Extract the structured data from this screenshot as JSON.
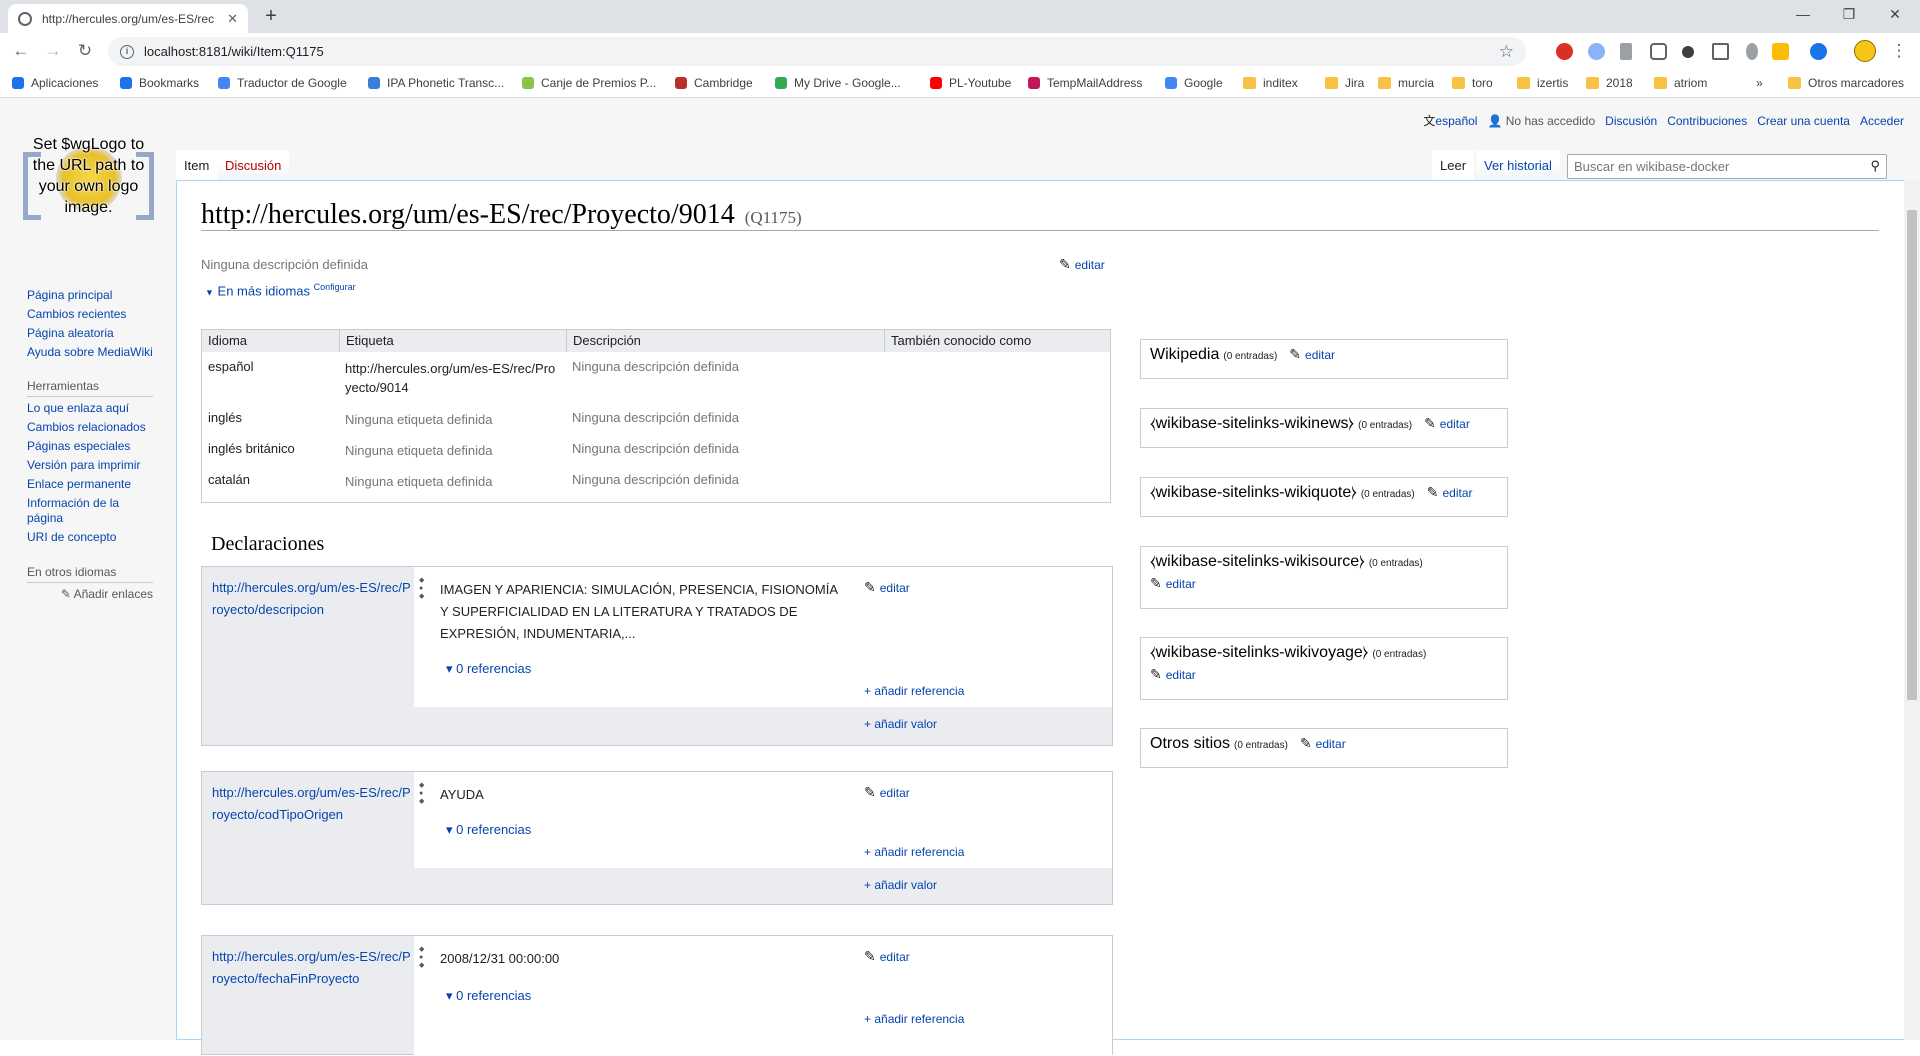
{
  "browser": {
    "tab_title": "http://hercules.org/um/es-ES/rec",
    "url": "localhost:8181/wiki/Item:Q1175",
    "bookmarks": [
      {
        "label": "Aplicaciones",
        "icon": "apps-grid-icon"
      },
      {
        "label": "Bookmarks",
        "icon": "star-icon"
      },
      {
        "label": "Traductor de Google",
        "icon": "translate-icon"
      },
      {
        "label": "IPA Phonetic Transc...",
        "icon": "ipa-icon"
      },
      {
        "label": "Canje de Premios P...",
        "icon": "prize-icon"
      },
      {
        "label": "Cambridge",
        "icon": "cambridge-icon"
      },
      {
        "label": "My Drive - Google...",
        "icon": "drive-icon"
      },
      {
        "label": "PL-Youtube",
        "icon": "youtube-icon"
      },
      {
        "label": "TempMailAddress",
        "icon": "tempmail-icon"
      },
      {
        "label": "Google",
        "icon": "google-icon"
      },
      {
        "label": "inditex",
        "icon": "folder-icon"
      },
      {
        "label": "Jira",
        "icon": "folder-icon"
      },
      {
        "label": "murcia",
        "icon": "folder-icon"
      },
      {
        "label": "toro",
        "icon": "folder-icon"
      },
      {
        "label": "izertis",
        "icon": "folder-icon"
      },
      {
        "label": "2018",
        "icon": "folder-icon"
      },
      {
        "label": "atriom",
        "icon": "folder-icon"
      }
    ],
    "more_bookmarks": "»",
    "other_bookmarks": "Otros marcadores"
  },
  "logo": {
    "text": "Set $wgLogo to the URL path to your own logo image."
  },
  "sidebar": {
    "nav": [
      "Página principal",
      "Cambios recientes",
      "Página aleatoria",
      "Ayuda sobre MediaWiki"
    ],
    "tools_title": "Herramientas",
    "tools": [
      "Lo que enlaza aquí",
      "Cambios relacionados",
      "Páginas especiales",
      "Versión para imprimir",
      "Enlace permanente",
      "Información de la página",
      "URI de concepto"
    ],
    "langs_title": "En otros idiomas",
    "add_links": "Añadir enlaces"
  },
  "personal": {
    "language": "español",
    "not_logged": "No has accedido",
    "talk": "Discusión",
    "contribs": "Contribuciones",
    "create": "Crear una cuenta",
    "login": "Acceder"
  },
  "tabs": {
    "item": "Item",
    "discussion": "Discusión",
    "read": "Leer",
    "history": "Ver historial"
  },
  "search": {
    "placeholder": "Buscar en wikibase-docker"
  },
  "page": {
    "title": "http://hercules.org/um/es-ES/rec/Proyecto/9014",
    "qid": "(Q1175)",
    "description": "Ninguna descripción definida",
    "edit": "editar",
    "more_langs": "En más idiomas",
    "configure": "Configurar"
  },
  "terms": {
    "headers": [
      "Idioma",
      "Etiqueta",
      "Descripción",
      "También conocido como"
    ],
    "rows": [
      {
        "lang": "español",
        "label": "http://hercules.org/um/es-ES/rec/Proyecto/9014",
        "desc": "Ninguna descripción definida",
        "aliases": ""
      },
      {
        "lang": "inglés",
        "label": "Ninguna etiqueta definida",
        "desc": "Ninguna descripción definida",
        "aliases": ""
      },
      {
        "lang": "inglés británico",
        "label": "Ninguna etiqueta definida",
        "desc": "Ninguna descripción definida",
        "aliases": ""
      },
      {
        "lang": "catalán",
        "label": "Ninguna etiqueta definida",
        "desc": "Ninguna descripción definida",
        "aliases": ""
      }
    ]
  },
  "statements": {
    "heading": "Declaraciones",
    "edit": "editar",
    "add_reference": "añadir referencia",
    "add_value": "añadir valor",
    "items": [
      {
        "property": "http://hercules.org/um/es-ES/rec/Proyecto/descripcion",
        "value": "IMAGEN Y APARIENCIA: SIMULACIÓN, PRESENCIA, FISIONOMÍA Y SUPERFICIALIDAD EN LA LITERATURA Y TRATADOS DE EXPRESIÓN, INDUMENTARIA,...",
        "refs": "0 referencias"
      },
      {
        "property": "http://hercules.org/um/es-ES/rec/Proyecto/codTipoOrigen",
        "value": "AYUDA",
        "refs": "0 referencias"
      },
      {
        "property": "http://hercules.org/um/es-ES/rec/Proyecto/fechaFinProyecto",
        "value": "2008/12/31 00:00:00",
        "refs": "0 referencias"
      }
    ]
  },
  "sitelinks": {
    "edit": "editar",
    "groups": [
      {
        "name": "Wikipedia",
        "count": "(0 entradas)"
      },
      {
        "name": "⧼wikibase-sitelinks-wikinews⧽",
        "count": "(0 entradas)"
      },
      {
        "name": "⧼wikibase-sitelinks-wikiquote⧽",
        "count": "(0 entradas)"
      },
      {
        "name": "⧼wikibase-sitelinks-wikisource⧽",
        "count": "(0 entradas)"
      },
      {
        "name": "⧼wikibase-sitelinks-wikivoyage⧽",
        "count": "(0 entradas)"
      },
      {
        "name": "Otros sitios",
        "count": "(0 entradas)"
      }
    ]
  }
}
